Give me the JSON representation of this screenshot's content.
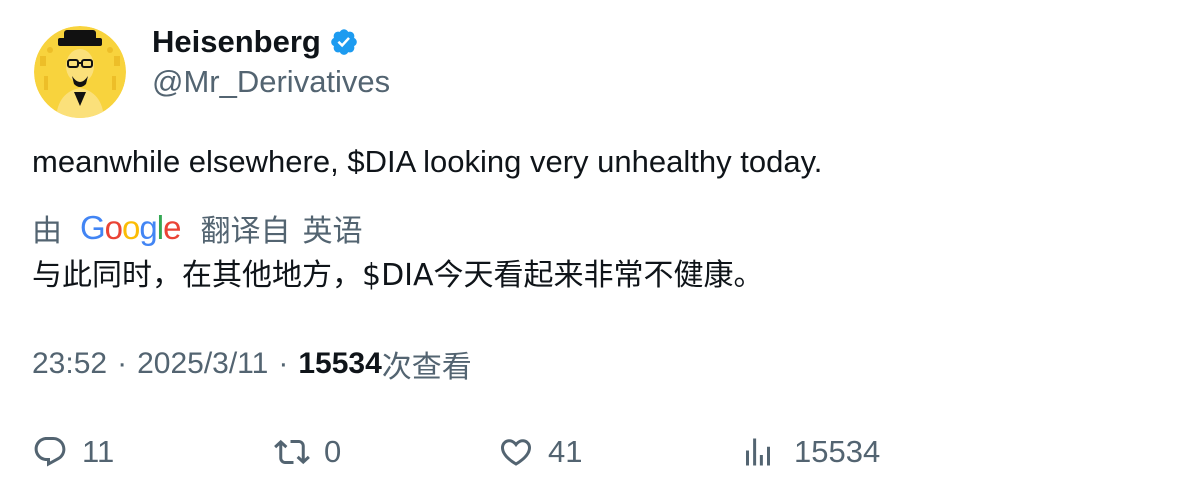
{
  "author": {
    "display_name": "Heisenberg",
    "handle": "@Mr_Derivatives",
    "verified": true,
    "verified_color": "#1d9bf0",
    "avatar_bg": "#f8d33d"
  },
  "tweet": {
    "text": "meanwhile elsewhere, $DIA looking very unhealthy today."
  },
  "translation": {
    "prefix": "由",
    "provider": "Google",
    "label": "翻译自",
    "source_language": "英语",
    "text": "与此同时，在其他地方，$DIA今天看起来非常不健康。"
  },
  "meta": {
    "time": "23:52",
    "separator": "·",
    "date": "2025/3/11",
    "view_count": "15534",
    "views_label": "次查看"
  },
  "actions": {
    "replies": "11",
    "retweets": "0",
    "likes": "41",
    "views": "15534"
  },
  "colors": {
    "text_primary": "#0f1419",
    "text_secondary": "#536471",
    "google_blue": "#4285f4",
    "google_red": "#ea4335",
    "google_yellow": "#fbbc05",
    "google_green": "#34a853"
  }
}
